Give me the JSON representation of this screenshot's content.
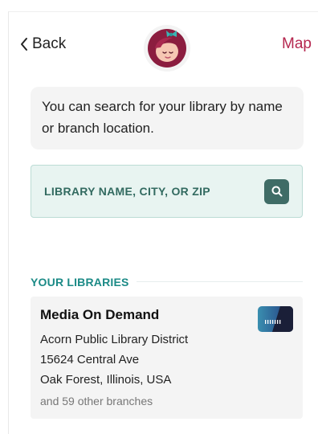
{
  "header": {
    "back_label": "Back",
    "map_label": "Map"
  },
  "intro": {
    "text": "You can search for your library by name or branch location."
  },
  "search": {
    "placeholder": "LIBRARY NAME, CITY, OR ZIP",
    "value": ""
  },
  "libraries": {
    "section_title": "YOUR LIBRARIES",
    "items": [
      {
        "name": "Media On Demand",
        "district": "Acorn Public Library District",
        "address": "15624 Central Ave",
        "city": "Oak Forest, Illinois, USA",
        "branches": "and 59 other branches"
      }
    ]
  },
  "colors": {
    "accent": "#b5274f",
    "teal": "#1b8a86",
    "search_bg": "#e8f4f1",
    "search_button": "#3f6c66"
  }
}
